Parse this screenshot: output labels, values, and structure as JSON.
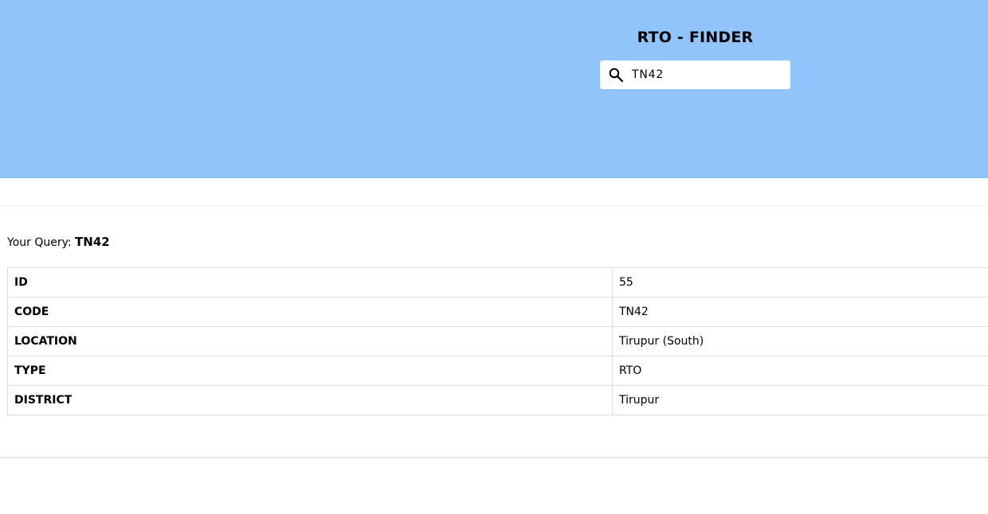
{
  "header": {
    "title": "RTO - FINDER",
    "background_color": "#90c4fa"
  },
  "search": {
    "icon": "search-icon",
    "value": "TN42"
  },
  "query": {
    "label": "Your Query:",
    "value": "TN42"
  },
  "result": {
    "rows": [
      {
        "key": "ID",
        "value": "55"
      },
      {
        "key": "CODE",
        "value": "TN42"
      },
      {
        "key": "LOCATION",
        "value": "Tirupur (South)"
      },
      {
        "key": "TYPE",
        "value": "RTO"
      },
      {
        "key": "DISTRICT",
        "value": "Tirupur"
      }
    ]
  }
}
